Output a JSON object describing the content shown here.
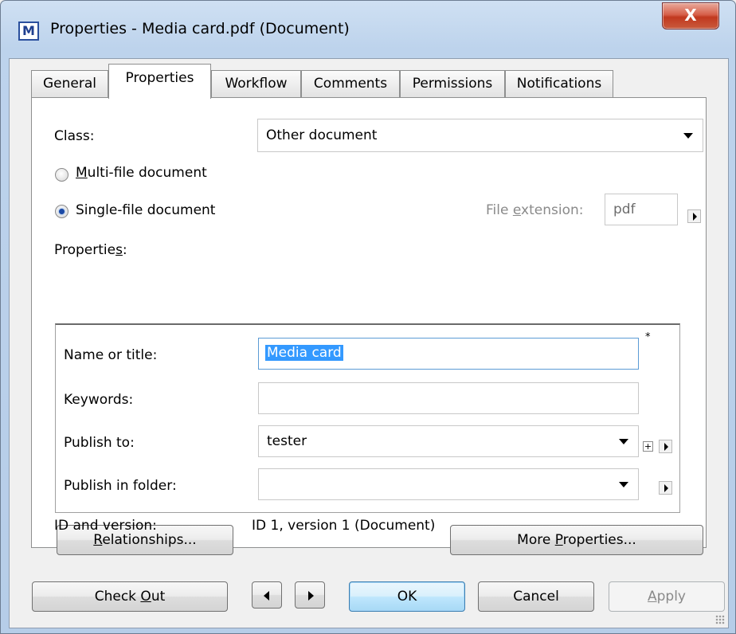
{
  "window": {
    "icon_letter": "M",
    "title": "Properties - Media card.pdf (Document)",
    "close_glyph": "X"
  },
  "tabs": [
    {
      "label": "General",
      "active": false
    },
    {
      "label": "Properties",
      "active": true
    },
    {
      "label": "Workflow",
      "active": false
    },
    {
      "label": "Comments",
      "active": false
    },
    {
      "label": "Permissions",
      "active": false
    },
    {
      "label": "Notifications",
      "active": false
    }
  ],
  "class_field": {
    "label": "Class:",
    "value": "Other document"
  },
  "doc_type": {
    "multi": {
      "prefix": "",
      "key": "M",
      "rest": "ulti-file document",
      "checked": false
    },
    "single": {
      "prefix": "Sin",
      "key": "g",
      "rest": "le-file document",
      "checked": true
    }
  },
  "file_extension": {
    "label_prefix": "File ",
    "label_key": "e",
    "label_rest": "xtension:",
    "value": "pdf"
  },
  "properties_label": {
    "prefix": "Propertie",
    "key": "s",
    "rest": ":"
  },
  "properties": [
    {
      "label": "Name or title:",
      "value": "Media card",
      "required_mark": "*"
    },
    {
      "label": "Keywords:",
      "value": ""
    },
    {
      "label": "Publish to:",
      "value": "tester"
    },
    {
      "label": "Publish in folder:",
      "value": ""
    }
  ],
  "buttons": {
    "relationships": {
      "key": "R",
      "rest": "elationships..."
    },
    "more_properties": {
      "prefix": "More ",
      "key": "P",
      "rest": "roperties..."
    },
    "check_out": {
      "prefix": "Check ",
      "key": "O",
      "rest": "ut"
    },
    "ok": "OK",
    "cancel": "Cancel",
    "apply": {
      "key": "A",
      "rest": "pply"
    }
  },
  "id_version": {
    "label": "ID and version:",
    "value": "ID 1, version 1 (Document)"
  },
  "icons": [
    "app-logo-icon",
    "close-icon",
    "dropdown-arrow-icon",
    "expand-arrow-icon",
    "add-plus-icon",
    "prev-arrow-icon",
    "next-arrow-icon",
    "resize-grip-icon"
  ]
}
